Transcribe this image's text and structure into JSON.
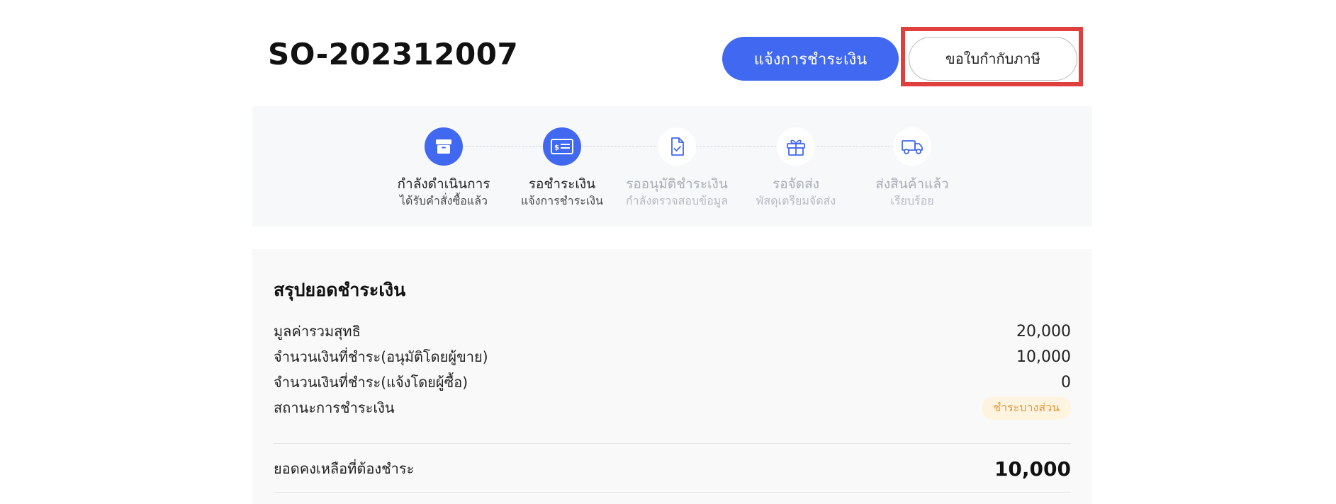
{
  "header": {
    "order_number": "SO-202312007",
    "notify_payment_label": "แจ้งการชำระเงิน",
    "request_tax_invoice_label": "ขอใบกำกับภาษี"
  },
  "stepper": {
    "steps": [
      {
        "title": "กำลังดำเนินการ",
        "subtitle": "ได้รับคำสั่งซื้อแล้ว",
        "icon": "box-icon",
        "state": "active"
      },
      {
        "title": "รอชำระเงิน",
        "subtitle": "แจ้งการชำระเงิน",
        "icon": "payment-card-icon",
        "state": "active"
      },
      {
        "title": "รออนุมัติชำระเงิน",
        "subtitle": "กำลังตรวจสอบข้อมูล",
        "icon": "document-check-icon",
        "state": "inactive"
      },
      {
        "title": "รอจัดส่ง",
        "subtitle": "พัสดุเตรียมจัดส่ง",
        "icon": "gift-box-icon",
        "state": "inactive"
      },
      {
        "title": "ส่งสินค้าแล้ว",
        "subtitle": "เรียบร้อย",
        "icon": "delivery-truck-icon",
        "state": "inactive"
      }
    ]
  },
  "summary": {
    "title": "สรุปยอดชำระเงิน",
    "rows": [
      {
        "label": "มูลค่ารวมสุทธิ",
        "value": "20,000"
      },
      {
        "label": "จำนวนเงินที่ชำระ(อนุมัติโดยผู้ขาย)",
        "value": "10,000"
      },
      {
        "label": "จำนวนเงินที่ชำระ(แจ้งโดยผู้ซื้อ)",
        "value": "0"
      }
    ],
    "status_label": "สถานะการชำระเงิน",
    "status_value": "ชำระบางส่วน",
    "balance_label": "ยอดคงเหลือที่ต้องชำระ",
    "balance_value": "10,000"
  },
  "colors": {
    "accent": "#4168f0",
    "highlight_border": "#e0403d",
    "status_badge_bg": "#fff4e0",
    "status_badge_text": "#e39a3e",
    "inactive_text": "#a9adb6"
  }
}
